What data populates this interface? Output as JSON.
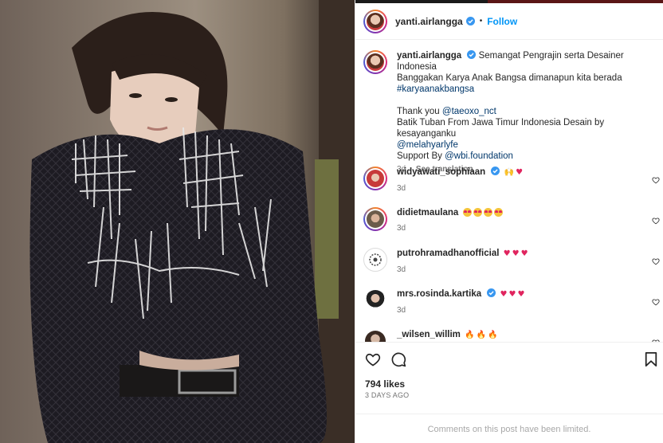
{
  "post": {
    "author": "yanti.airlangga",
    "follow_label": "Follow",
    "dot": "•",
    "caption": {
      "line1": "Semangat Pengrajin serta Desainer Indonesia",
      "line2": "Banggakan Karya Anak Bangsa dimanapun kita berada",
      "hashtag": "#karyaanakbangsa",
      "thanks_prefix": "Thank you ",
      "thanks_mention": "@taeoxo_nct",
      "batik": "Batik Tuban From Jawa Timur Indonesia Desain by kesayanganku",
      "designer_mention": "@melahyarlyfe",
      "support_prefix": "Support By ",
      "support_mention": "@wbi.foundation",
      "age": "3d",
      "see_translation": "See translation"
    }
  },
  "comments": [
    {
      "user": "widyawati_sophiaan",
      "verified": true,
      "emojis": [
        "raising-hands",
        "red-heart"
      ],
      "age": "3d"
    },
    {
      "user": "didietmaulana",
      "verified": false,
      "emojis": [
        "heart-eyes",
        "heart-eyes",
        "heart-eyes",
        "heart-eyes"
      ],
      "age": "3d"
    },
    {
      "user": "putrohramadhanofficial",
      "verified": false,
      "emojis": [
        "red-heart",
        "red-heart",
        "red-heart"
      ],
      "age": "3d"
    },
    {
      "user": "mrs.rosinda.kartika",
      "verified": true,
      "emojis": [
        "red-heart",
        "red-heart",
        "red-heart"
      ],
      "age": "3d"
    },
    {
      "user": "_wilsen_willim",
      "verified": false,
      "emojis": [
        "fire",
        "fire",
        "fire"
      ],
      "age": ""
    }
  ],
  "footer": {
    "likes": "794 likes",
    "date": "3 days ago",
    "comments_limited": "Comments on this post have been limited."
  },
  "colors": {
    "accent": "#0095f6",
    "verified": "#3897f0",
    "heart": "#e0245e",
    "link": "#00376b"
  },
  "icons": [
    "like-icon",
    "comment-icon",
    "save-icon",
    "verified-badge-icon",
    "comment-like-icon"
  ]
}
